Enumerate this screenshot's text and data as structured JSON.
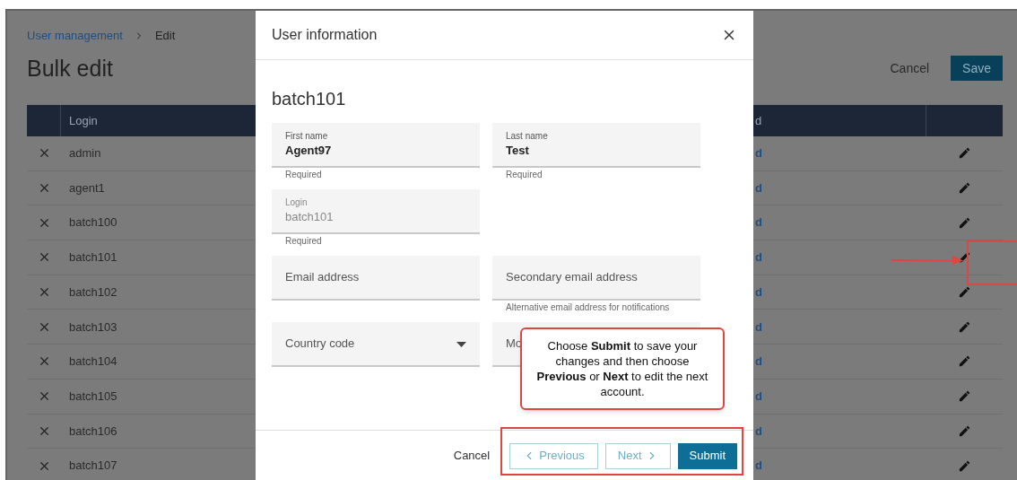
{
  "breadcrumb": [
    {
      "text": "User management",
      "kind": "link"
    },
    {
      "text": "Edit",
      "kind": "current"
    }
  ],
  "page_title": "Bulk edit",
  "actions": [
    {
      "label": "Cancel",
      "kind": "plain"
    },
    {
      "label": "Save",
      "kind": "primary"
    }
  ],
  "table": {
    "columns": [
      "Login",
      "d"
    ],
    "rows": [
      {
        "login": "admin",
        "column_3": "d"
      },
      {
        "login": "agent1",
        "column_3": "d"
      },
      {
        "login": "batch100",
        "column_3": "d"
      },
      {
        "login": "batch101",
        "column_3": "d"
      },
      {
        "login": "batch102",
        "column_3": "d"
      },
      {
        "login": "batch103",
        "column_3": "d"
      },
      {
        "login": "batch104",
        "column_3": "d"
      },
      {
        "login": "batch105",
        "column_3": "d"
      },
      {
        "login": "batch106",
        "column_3": "d"
      },
      {
        "login": "batch107",
        "column_3": "d"
      }
    ]
  },
  "modal": {
    "title": "User information",
    "heading": "batch101",
    "field_rows": [
      [
        {
          "kind": "text",
          "label": "First name",
          "value": "Agent97",
          "hint": "Required",
          "disabled": false
        },
        {
          "kind": "text",
          "label": "Last name",
          "value": "Test",
          "hint": "Required",
          "disabled": false
        }
      ],
      [
        {
          "kind": "text",
          "label": "Login",
          "value": "batch101",
          "hint": "Required",
          "disabled": true
        }
      ],
      [
        {
          "kind": "text",
          "placeholder": "Email address",
          "disabled": false
        },
        {
          "kind": "text",
          "placeholder": "Secondary email address",
          "hint": "Alternative email address for notifications",
          "disabled": false
        }
      ],
      [
        {
          "kind": "select",
          "placeholder": "Country code",
          "disabled": false
        },
        {
          "kind": "text",
          "placeholder": "Mo",
          "disabled": false
        }
      ]
    ],
    "footer": [
      {
        "label": "Cancel",
        "kind": "plain"
      },
      {
        "label": "Previous",
        "kind": "prev"
      },
      {
        "label": "Next",
        "kind": "next"
      },
      {
        "label": "Submit",
        "kind": "primary"
      }
    ]
  },
  "callout": "Choose **Submit** to save your changes and then choose **Previous** or **Next** to edit the next account."
}
